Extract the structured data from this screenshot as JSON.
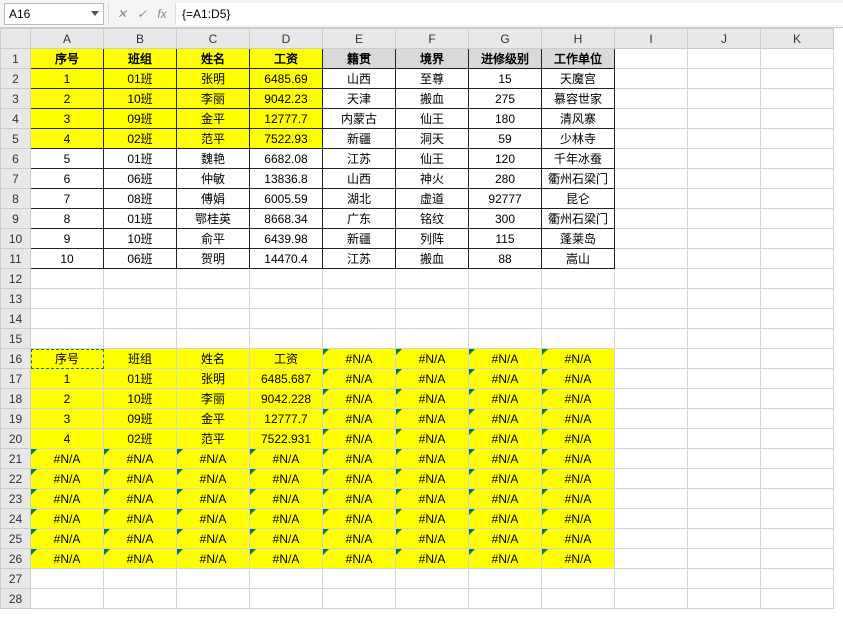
{
  "formula_bar": {
    "name_box": "A16",
    "cancel_glyph": "✕",
    "confirm_glyph": "✓",
    "fx_glyph": "fx",
    "formula": "{=A1:D5}"
  },
  "columns": [
    "A",
    "B",
    "C",
    "D",
    "E",
    "F",
    "G",
    "H",
    "I",
    "J",
    "K"
  ],
  "row_count": 28,
  "na": "#N/A",
  "chart_data": {
    "type": "table",
    "headers_yellow": [
      "序号",
      "班组",
      "姓名",
      "工资"
    ],
    "headers_gray": [
      "籍贯",
      "境界",
      "进修级别",
      "工作单位"
    ],
    "rows": [
      [
        "1",
        "01班",
        "张明",
        "6485.69",
        "山西",
        "至尊",
        "15",
        "天魔宫"
      ],
      [
        "2",
        "10班",
        "李丽",
        "9042.23",
        "天津",
        "搬血",
        "275",
        "慕容世家"
      ],
      [
        "3",
        "09班",
        "金平",
        "12777.7",
        "内蒙古",
        "仙王",
        "180",
        "清风寨"
      ],
      [
        "4",
        "02班",
        "范平",
        "7522.93",
        "新疆",
        "洞天",
        "59",
        "少林寺"
      ],
      [
        "5",
        "01班",
        "魏艳",
        "6682.08",
        "江苏",
        "仙王",
        "120",
        "千年冰蚕"
      ],
      [
        "6",
        "06班",
        "仲敏",
        "13836.8",
        "山西",
        "神火",
        "280",
        "衢州石梁门"
      ],
      [
        "7",
        "08班",
        "傅娟",
        "6005.59",
        "湖北",
        "虚道",
        "92777",
        "昆仑"
      ],
      [
        "8",
        "01班",
        "鄂桂英",
        "8668.34",
        "广东",
        "铭纹",
        "300",
        "衢州石梁门"
      ],
      [
        "9",
        "10班",
        "俞平",
        "6439.98",
        "新疆",
        "列阵",
        "115",
        "蓬莱岛"
      ],
      [
        "10",
        "06班",
        "贺明",
        "14470.4",
        "江苏",
        "搬血",
        "88",
        "嵩山"
      ]
    ],
    "array_block_start_row": 16,
    "array_block": [
      [
        "序号",
        "班组",
        "姓名",
        "工资",
        "#N/A",
        "#N/A",
        "#N/A",
        "#N/A"
      ],
      [
        "1",
        "01班",
        "张明",
        "6485.687",
        "#N/A",
        "#N/A",
        "#N/A",
        "#N/A"
      ],
      [
        "2",
        "10班",
        "李丽",
        "9042.228",
        "#N/A",
        "#N/A",
        "#N/A",
        "#N/A"
      ],
      [
        "3",
        "09班",
        "金平",
        "12777.7",
        "#N/A",
        "#N/A",
        "#N/A",
        "#N/A"
      ],
      [
        "4",
        "02班",
        "范平",
        "7522.931",
        "#N/A",
        "#N/A",
        "#N/A",
        "#N/A"
      ],
      [
        "#N/A",
        "#N/A",
        "#N/A",
        "#N/A",
        "#N/A",
        "#N/A",
        "#N/A",
        "#N/A"
      ],
      [
        "#N/A",
        "#N/A",
        "#N/A",
        "#N/A",
        "#N/A",
        "#N/A",
        "#N/A",
        "#N/A"
      ],
      [
        "#N/A",
        "#N/A",
        "#N/A",
        "#N/A",
        "#N/A",
        "#N/A",
        "#N/A",
        "#N/A"
      ],
      [
        "#N/A",
        "#N/A",
        "#N/A",
        "#N/A",
        "#N/A",
        "#N/A",
        "#N/A",
        "#N/A"
      ],
      [
        "#N/A",
        "#N/A",
        "#N/A",
        "#N/A",
        "#N/A",
        "#N/A",
        "#N/A",
        "#N/A"
      ],
      [
        "#N/A",
        "#N/A",
        "#N/A",
        "#N/A",
        "#N/A",
        "#N/A",
        "#N/A",
        "#N/A"
      ]
    ]
  }
}
